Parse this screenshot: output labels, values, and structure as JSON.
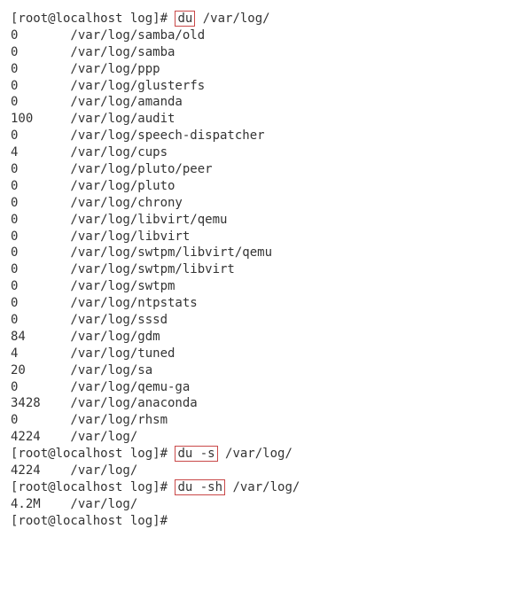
{
  "prompt": {
    "user": "root",
    "host": "localhost",
    "dir": "log",
    "suffix": "#"
  },
  "cmd1": {
    "command": "du",
    "arg": "/var/log/"
  },
  "cmd1_out": [
    {
      "size": "0",
      "path": "/var/log/samba/old"
    },
    {
      "size": "0",
      "path": "/var/log/samba"
    },
    {
      "size": "0",
      "path": "/var/log/ppp"
    },
    {
      "size": "0",
      "path": "/var/log/glusterfs"
    },
    {
      "size": "0",
      "path": "/var/log/amanda"
    },
    {
      "size": "100",
      "path": "/var/log/audit"
    },
    {
      "size": "0",
      "path": "/var/log/speech-dispatcher"
    },
    {
      "size": "4",
      "path": "/var/log/cups"
    },
    {
      "size": "0",
      "path": "/var/log/pluto/peer"
    },
    {
      "size": "0",
      "path": "/var/log/pluto"
    },
    {
      "size": "0",
      "path": "/var/log/chrony"
    },
    {
      "size": "0",
      "path": "/var/log/libvirt/qemu"
    },
    {
      "size": "0",
      "path": "/var/log/libvirt"
    },
    {
      "size": "0",
      "path": "/var/log/swtpm/libvirt/qemu"
    },
    {
      "size": "0",
      "path": "/var/log/swtpm/libvirt"
    },
    {
      "size": "0",
      "path": "/var/log/swtpm"
    },
    {
      "size": "0",
      "path": "/var/log/ntpstats"
    },
    {
      "size": "0",
      "path": "/var/log/sssd"
    },
    {
      "size": "84",
      "path": "/var/log/gdm"
    },
    {
      "size": "4",
      "path": "/var/log/tuned"
    },
    {
      "size": "20",
      "path": "/var/log/sa"
    },
    {
      "size": "0",
      "path": "/var/log/qemu-ga"
    },
    {
      "size": "3428",
      "path": "/var/log/anaconda"
    },
    {
      "size": "0",
      "path": "/var/log/rhsm"
    },
    {
      "size": "4224",
      "path": "/var/log/"
    }
  ],
  "cmd2": {
    "command": "du -s",
    "arg": "/var/log/"
  },
  "cmd2_out": [
    {
      "size": "4224",
      "path": "/var/log/"
    }
  ],
  "cmd3": {
    "command": "du -sh",
    "arg": "/var/log/"
  },
  "cmd3_out": [
    {
      "size": "4.2M",
      "path": "/var/log/"
    }
  ]
}
